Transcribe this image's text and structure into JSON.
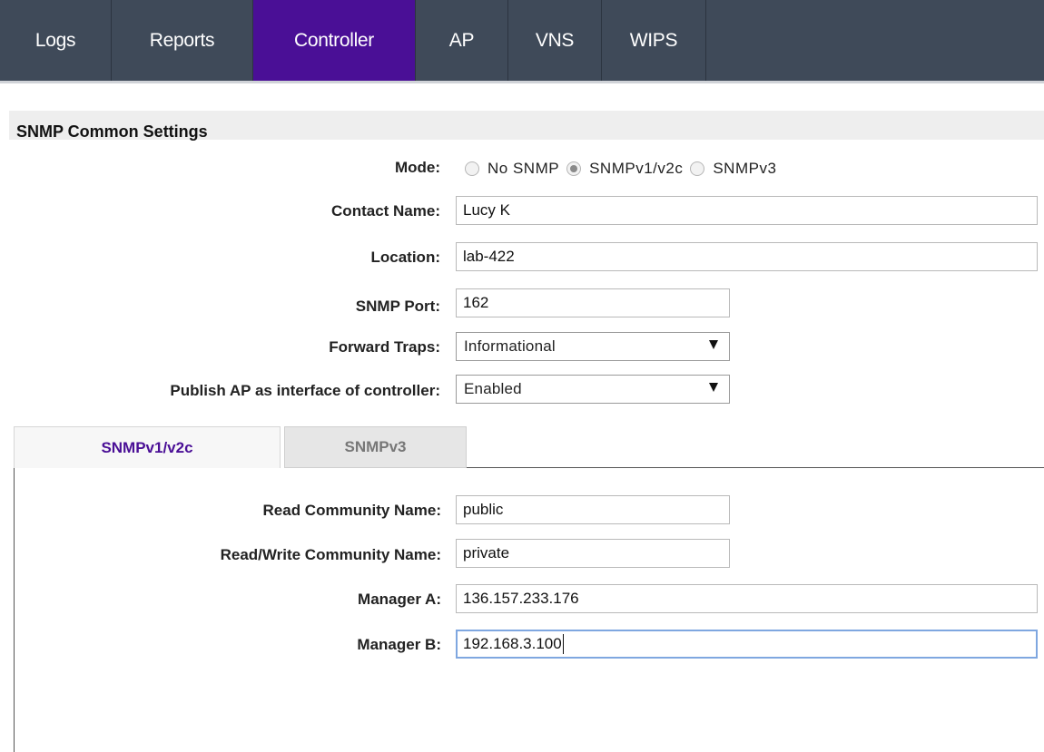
{
  "nav": {
    "tabs": [
      {
        "label": "Logs",
        "active": false
      },
      {
        "label": "Reports",
        "active": false
      },
      {
        "label": "Controller",
        "active": true
      },
      {
        "label": "AP",
        "active": false
      },
      {
        "label": "VNS",
        "active": false
      },
      {
        "label": "WIPS",
        "active": false
      }
    ]
  },
  "section": {
    "title": "SNMP Common Settings"
  },
  "form": {
    "mode": {
      "label": "Mode:",
      "options": [
        "No SNMP",
        "SNMPv1/v2c",
        "SNMPv3"
      ],
      "selected": "SNMPv1/v2c"
    },
    "contact_name": {
      "label": "Contact Name:",
      "value": "Lucy K"
    },
    "location": {
      "label": "Location:",
      "value": "lab-422"
    },
    "snmp_port": {
      "label": "SNMP Port:",
      "value": "162"
    },
    "forward_traps": {
      "label": "Forward Traps:",
      "value": "Informational"
    },
    "publish_ap": {
      "label": "Publish AP as interface of controller:",
      "value": "Enabled"
    }
  },
  "subtabs": [
    {
      "label": "SNMPv1/v2c",
      "active": true
    },
    {
      "label": "SNMPv3",
      "active": false
    }
  ],
  "v1v2c": {
    "read_community": {
      "label": "Read Community Name:",
      "value": "public"
    },
    "rw_community": {
      "label": "Read/Write Community Name:",
      "value": "private"
    },
    "manager_a": {
      "label": "Manager A:",
      "value": "136.157.233.176"
    },
    "manager_b": {
      "label": "Manager B:",
      "value": "192.168.3.100"
    }
  },
  "colors": {
    "nav_bg": "#3f4a59",
    "nav_active": "#4a0f96",
    "active_subtab_text": "#4a0f96",
    "focus_border": "#7fa7e0"
  }
}
